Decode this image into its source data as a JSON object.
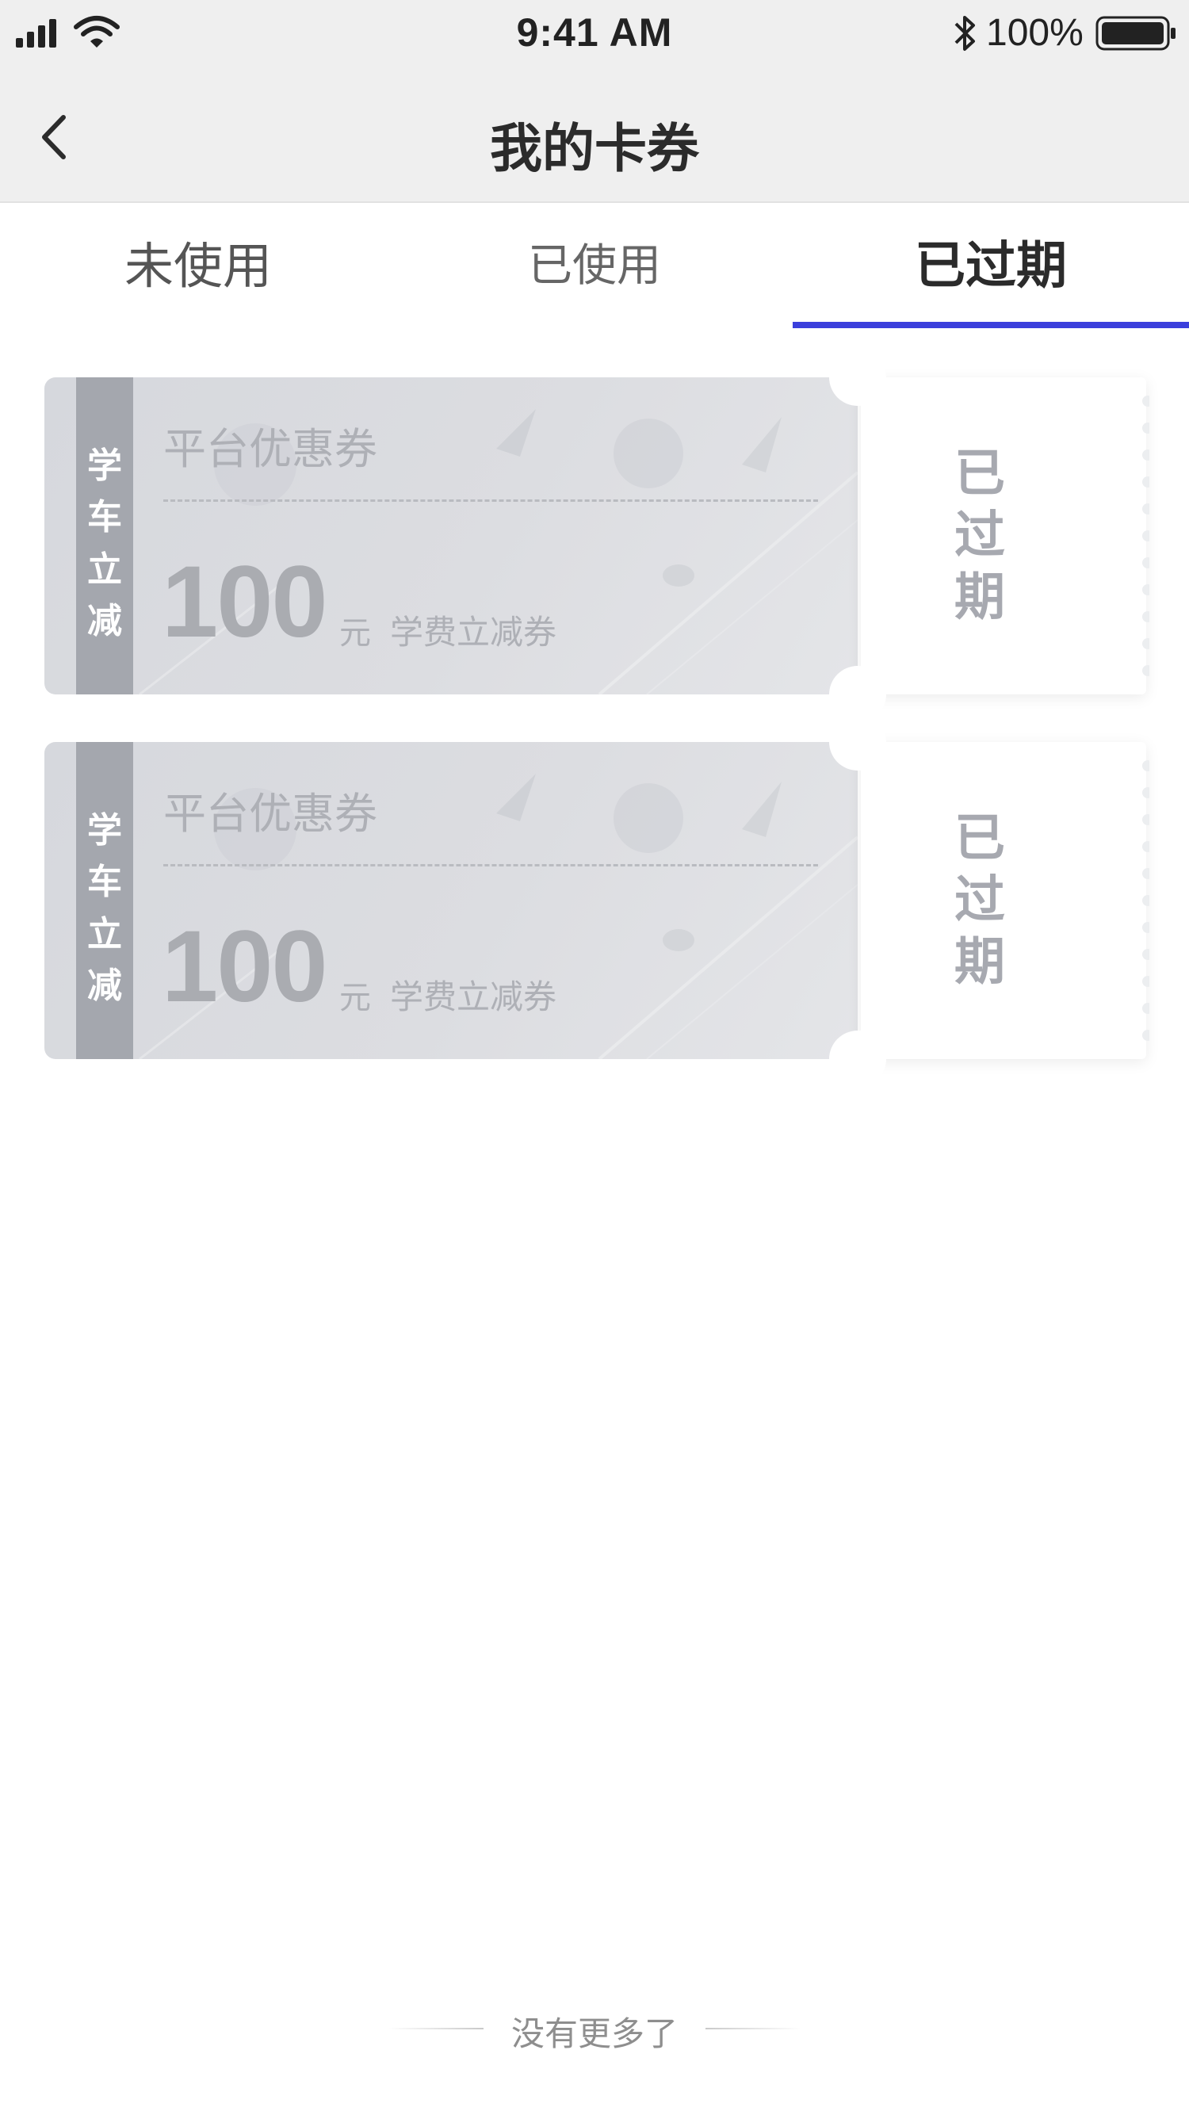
{
  "status_bar": {
    "time": "9:41 AM",
    "battery_text": "100%",
    "icons": [
      "signal-icon",
      "wifi-icon",
      "bluetooth-icon",
      "battery-icon"
    ]
  },
  "nav": {
    "title": "我的卡券",
    "back_icon": "chevron-left-icon"
  },
  "tabs": [
    {
      "label": "未使用",
      "active": false
    },
    {
      "label": "已使用",
      "active": false
    },
    {
      "label": "已过期",
      "active": true
    }
  ],
  "colors": {
    "accent": "#3b3fdc",
    "expired_text": "#a7a9b0",
    "coupon_bg": "#dcdde1",
    "strip": "#a4a7ae"
  },
  "coupons": [
    {
      "strip_chars": [
        "学",
        "车",
        "立",
        "减"
      ],
      "type": "平台优惠券",
      "amount": "100",
      "unit": "元",
      "desc": "学费立减券",
      "status_chars": [
        "已",
        "过",
        "期"
      ]
    },
    {
      "strip_chars": [
        "学",
        "车",
        "立",
        "减"
      ],
      "type": "平台优惠券",
      "amount": "100",
      "unit": "元",
      "desc": "学费立减券",
      "status_chars": [
        "已",
        "过",
        "期"
      ]
    }
  ],
  "footer": {
    "text": "没有更多了"
  }
}
